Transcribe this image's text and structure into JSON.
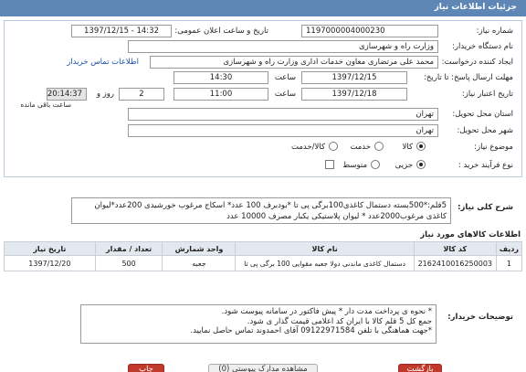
{
  "header": {
    "title": "جزئیات اطلاعات نیاز"
  },
  "form": {
    "need_number_label": "شماره نیاز:",
    "need_number": "1197000004000230",
    "announce_label": "تاریخ و ساعت اعلان عمومی:",
    "announce_value": "1397/12/15 - 14:32",
    "buyer_label": "نام دستگاه خریدار:",
    "buyer_value": "وزارت راه و شهرسازی",
    "creator_label": "ایجاد کننده درخواست:",
    "creator_value": "محمد علی  مرتضاری معاون خدمات اداری وزارت راه و شهرسازی",
    "contact_link": "اطلاعات تماس خریدار",
    "send_deadline_label": "مهلت ارسال پاسخ: تا تاریخ:",
    "send_date": "1397/12/15",
    "time_label": "ساعت",
    "send_time": "14:30",
    "validity_label": "تاریخ اعتبار نیاز:",
    "validity_date": "1397/12/18",
    "validity_time": "11:00",
    "days": "2",
    "days_label": "روز و",
    "remaining_time": "20:14:37",
    "remaining_label": "ساعت باقی مانده",
    "province_label": "استان محل تحویل:",
    "province_value": "تهران",
    "city_label": "شهر محل تحویل:",
    "city_value": "تهران",
    "category_label": "موضوع نیاز:",
    "category_options": [
      "کالا",
      "خدمت",
      "کالا/خدمت"
    ],
    "process_label": "نوع فرآیند خرید :",
    "process_options": [
      "جزیی",
      "متوسط"
    ],
    "desc_label": "شرح کلی نیاز:",
    "description": "5قلم:*500بسته دستمال کاغذی100برگی پی تا *بودبرف 100 عدد* اسکاج مرغوب خورشیدی 200عدد*لیوان کاغذی مرغوب2000عدد * لیوان پلاستیکی یکبار مصرف 10000 عدد"
  },
  "goods": {
    "section_title": "اطلاعات کالاهای مورد نیاز",
    "columns": [
      "ردیف",
      "کد کالا",
      "نام کالا",
      "واحد شمارش",
      "تعداد / مقدار",
      "تاریخ نیاز"
    ],
    "rows": [
      [
        "1",
        "2162410016250003",
        "دستمال کاغذی ماندنی دولا جعبه مقوایی 100 برگی پی تا",
        "جعبه",
        "500",
        "1397/12/20"
      ]
    ]
  },
  "notes": {
    "label": "توضیحات خریدار:",
    "lines": [
      "* نحوه ی پرداخت مدت دار  *  پیش فاکتور در سامانه پیوست شود.",
      "جمع کل 5 قلم کالا با ایران کد اعلامی قیمت گذار ی شود.",
      "*جهت هماهنگی با تلفن 09122971584 آقای احمدوند تماس حاصل نمایید."
    ]
  },
  "buttons": {
    "view_docs": "مشاهده مدارک پیوستی (0)",
    "print": "چاپ",
    "back": "بازگشت"
  }
}
